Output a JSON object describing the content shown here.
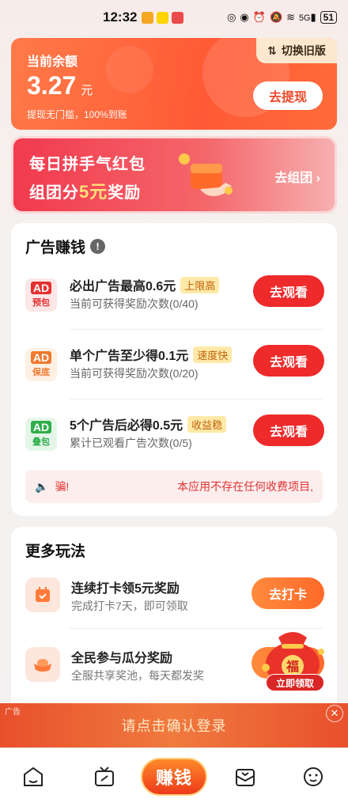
{
  "status_bar": {
    "time": "12:32",
    "network": "5G",
    "battery": "51"
  },
  "balance": {
    "label": "当前余额",
    "amount": "3.27",
    "unit": "元",
    "note": "提现无门槛，100%到账",
    "switch_label": "切换旧版",
    "withdraw_label": "去提现"
  },
  "banner": {
    "line1": "每日拼手气红包",
    "line2_prefix": "组团分",
    "line2_highlight": "5元",
    "line2_suffix": "奖励",
    "join_label": "去组团 ›"
  },
  "ads_section": {
    "title": "广告赚钱",
    "info_icon": "!",
    "items": [
      {
        "badge_top": "AD",
        "badge_bottom": "预包",
        "title": "必出广告最高0.6元",
        "tag": "上限高",
        "sub": "当前可获得奖励次数(0/40)",
        "button": "去观看",
        "badge_bg": "#fde6e6",
        "badge_color": "#e53030"
      },
      {
        "badge_top": "AD",
        "badge_bottom": "保底",
        "title": "单个广告至少得0.1元",
        "tag": "速度快",
        "sub": "当前可获得奖励次数(0/20)",
        "button": "去观看",
        "badge_bg": "#fff0e4",
        "badge_color": "#f07a30"
      },
      {
        "badge_top": "AD",
        "badge_bottom": "叠包",
        "title": "5个广告后必得0.5元",
        "tag": "收益稳",
        "sub": "累计已观看广告次数(0/5)",
        "button": "去观看",
        "badge_bg": "#e4f6e8",
        "badge_color": "#2fae4a"
      }
    ],
    "notice_left": "骗!",
    "notice_text": "本应用不存在任何收费项目,"
  },
  "more_section": {
    "title": "更多玩法",
    "items": [
      {
        "title": "连续打卡领5元奖励",
        "sub": "完成打卡7天，即可领取",
        "button": "去打卡",
        "icon": "calendar-check-icon"
      },
      {
        "title": "全民参与瓜分奖励",
        "sub": "全服共享奖池，每天都发奖",
        "button": "",
        "icon": "gold-ingot-icon"
      }
    ],
    "float_bag_char": "福",
    "float_bag_label": "立即领取"
  },
  "login_banner": {
    "ad_mark": "广告",
    "text": "请点击确认登录"
  },
  "nav": {
    "center_label": "赚钱",
    "items": [
      "home-icon",
      "tv-icon",
      "earn",
      "mail-icon",
      "profile-face-icon"
    ]
  },
  "colors": {
    "accent": "#ee2a2a",
    "orange": "#ff6a2a",
    "balance_bg": "#ff5a35"
  }
}
